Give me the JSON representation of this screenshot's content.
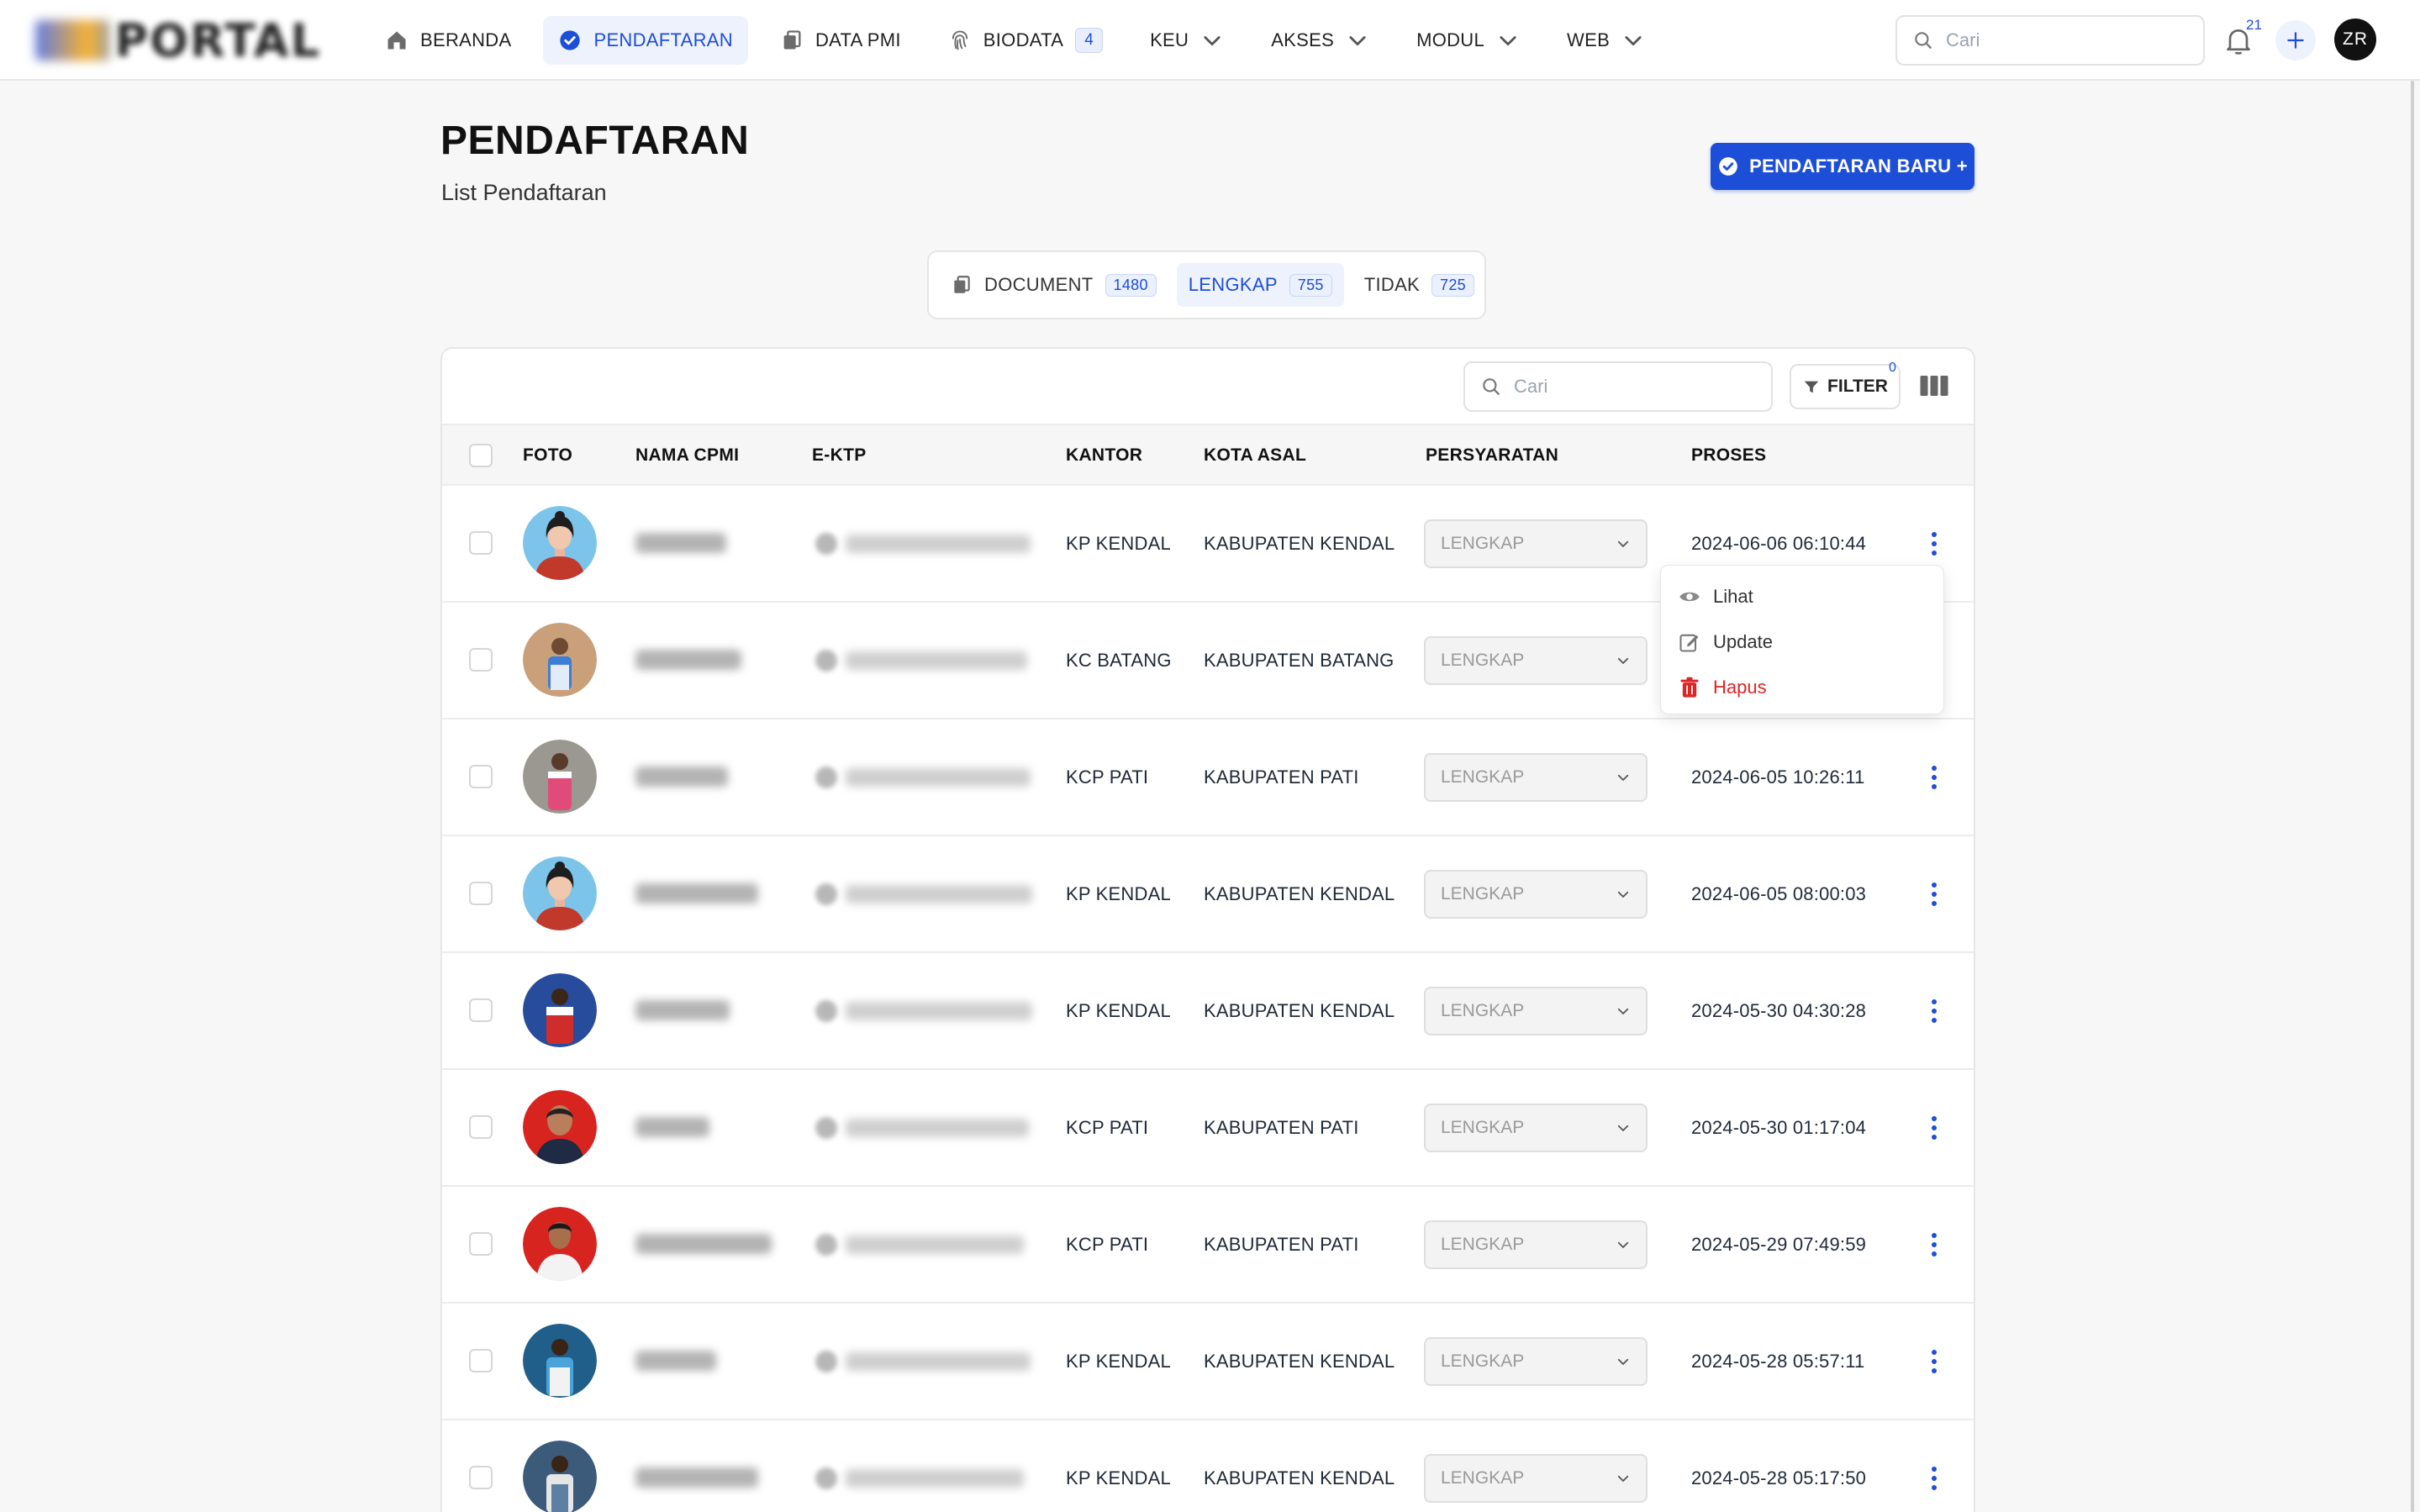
{
  "app": {
    "logo_text": "PORTAL"
  },
  "nav": {
    "items": [
      {
        "label": "BERANDA",
        "icon": "home-icon",
        "active": false
      },
      {
        "label": "PENDAFTARAN",
        "icon": "badge-check-icon",
        "active": true
      },
      {
        "label": "DATA PMI",
        "icon": "documents-icon",
        "active": false
      },
      {
        "label": "BIODATA",
        "icon": "fingerprint-icon",
        "active": false,
        "badge": "4"
      },
      {
        "label": "KEU",
        "dropdown": true
      },
      {
        "label": "AKSES",
        "dropdown": true
      },
      {
        "label": "MODUL",
        "dropdown": true
      },
      {
        "label": "WEB",
        "dropdown": true
      }
    ],
    "search_placeholder": "Cari",
    "notification_count": "21",
    "user_initials": "ZR"
  },
  "page": {
    "title": "PENDAFTARAN",
    "subtitle": "List Pendaftaran",
    "new_button": "PENDAFTARAN BARU +"
  },
  "tabs": [
    {
      "label": "DOCUMENT",
      "count": "1480",
      "active": false
    },
    {
      "label": "LENGKAP",
      "count": "755",
      "active": true
    },
    {
      "label": "TIDAK",
      "count": "725",
      "active": false
    }
  ],
  "table": {
    "search_placeholder": "Cari",
    "filter_label": "FILTER",
    "filter_count": "0",
    "columns": [
      "FOTO",
      "NAMA CPMI",
      "E-KTP",
      "KANTOR",
      "KOTA ASAL",
      "PERSYARATAN",
      "PROSES"
    ],
    "rows": [
      {
        "kantor": "KP KENDAL",
        "kota": "KABUPATEN KENDAL",
        "persyaratan": "LENGKAP",
        "proses": "2024-06-06 06:10:44",
        "photo": "avatar-illustration"
      },
      {
        "kantor": "KC BATANG",
        "kota": "KABUPATEN BATANG",
        "persyaratan": "LENGKAP",
        "proses": "",
        "photo": "photo-blue-uniform"
      },
      {
        "kantor": "KCP PATI",
        "kota": "KABUPATEN PATI",
        "persyaratan": "LENGKAP",
        "proses": "2024-06-05 10:26:11",
        "photo": "photo-pink-apron"
      },
      {
        "kantor": "KP KENDAL",
        "kota": "KABUPATEN KENDAL",
        "persyaratan": "LENGKAP",
        "proses": "2024-06-05 08:00:03",
        "photo": "avatar-illustration"
      },
      {
        "kantor": "KP KENDAL",
        "kota": "KABUPATEN KENDAL",
        "persyaratan": "LENGKAP",
        "proses": "2024-05-30 04:30:28",
        "photo": "photo-red-apron"
      },
      {
        "kantor": "KCP PATI",
        "kota": "KABUPATEN PATI",
        "persyaratan": "LENGKAP",
        "proses": "2024-05-30 01:17:04",
        "photo": "photo-red-background"
      },
      {
        "kantor": "KCP PATI",
        "kota": "KABUPATEN PATI",
        "persyaratan": "LENGKAP",
        "proses": "2024-05-29 07:49:59",
        "photo": "photo-white-shirt"
      },
      {
        "kantor": "KP KENDAL",
        "kota": "KABUPATEN KENDAL",
        "persyaratan": "LENGKAP",
        "proses": "2024-05-28 05:57:11",
        "photo": "photo-blue-shirt"
      },
      {
        "kantor": "KP KENDAL",
        "kota": "KABUPATEN KENDAL",
        "persyaratan": "LENGKAP",
        "proses": "2024-05-28 05:17:50",
        "photo": "photo-apron"
      }
    ]
  },
  "row_menu": {
    "items": [
      {
        "label": "Lihat",
        "icon": "eye-icon"
      },
      {
        "label": "Update",
        "icon": "edit-icon"
      },
      {
        "label": "Hapus",
        "icon": "trash-icon"
      }
    ]
  },
  "colors": {
    "accent": "#1d4ed8",
    "danger": "#dc2626"
  }
}
